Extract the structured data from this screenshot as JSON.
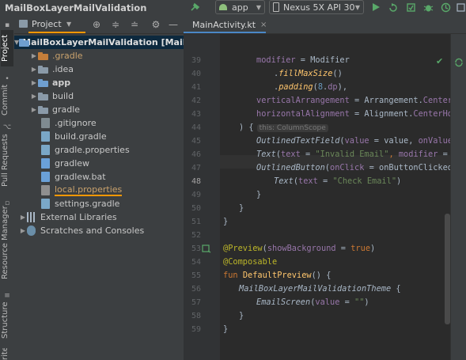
{
  "app": {
    "title": "MailBoxLayerMailValidation"
  },
  "toolbar": {
    "run_config": "app",
    "device": "Nexus 5X API 30"
  },
  "left_tabs": {
    "project": "Project",
    "commit": "Commit",
    "pull_requests": "Pull Requests",
    "resource_manager": "Resource Manager",
    "structure": "Structure",
    "favorites": "rites"
  },
  "project_panel": {
    "view_label": "Project",
    "tree": [
      {
        "label": "MailBoxLayerMailValidation [MailBoxLa",
        "level": 0,
        "type": "module",
        "expanded": true,
        "selected": true
      },
      {
        "label": ".gradle",
        "level": 1,
        "type": "folder-orange",
        "expanded": false
      },
      {
        "label": ".idea",
        "level": 1,
        "type": "folder",
        "expanded": false
      },
      {
        "label": "app",
        "level": 1,
        "type": "folder-module",
        "expanded": false
      },
      {
        "label": "build",
        "level": 1,
        "type": "folder",
        "expanded": false
      },
      {
        "label": "gradle",
        "level": 1,
        "type": "folder",
        "expanded": false
      },
      {
        "label": ".gitignore",
        "level": 1,
        "type": "file-git"
      },
      {
        "label": "build.gradle",
        "level": 1,
        "type": "file-gradle"
      },
      {
        "label": "gradle.properties",
        "level": 1,
        "type": "file-gradle"
      },
      {
        "label": "gradlew",
        "level": 1,
        "type": "file-sh"
      },
      {
        "label": "gradlew.bat",
        "level": 1,
        "type": "file-bat"
      },
      {
        "label": "local.properties",
        "level": 1,
        "type": "file-props"
      },
      {
        "label": "settings.gradle",
        "level": 1,
        "type": "file-gradle"
      },
      {
        "label": "External Libraries",
        "level": 0,
        "type": "libraries",
        "expanded": false
      },
      {
        "label": "Scratches and Consoles",
        "level": 0,
        "type": "scratches",
        "expanded": false
      }
    ]
  },
  "editor": {
    "tab_label": "MainActivity.kt",
    "inlay_hint": "this: ColumnScope",
    "current_line": "48",
    "line_numbers": [
      "39",
      "40",
      "41",
      "42",
      "43",
      "44",
      "45",
      "46",
      "47",
      "48",
      "49",
      "50",
      "51",
      "52",
      "53",
      "54",
      "55",
      "56",
      "57",
      "58",
      "59"
    ],
    "lines": {
      "l39": [
        [
          "modifier",
          "p"
        ],
        [
          " = Modifier",
          "d"
        ]
      ],
      "l40": [
        [
          ".",
          "d"
        ],
        [
          "fillMaxSize",
          "fi"
        ],
        [
          "()",
          "d"
        ]
      ],
      "l41": [
        [
          ".",
          "d"
        ],
        [
          "padding",
          "fi"
        ],
        [
          "(",
          "d"
        ],
        [
          "8",
          "n"
        ],
        [
          ".",
          "d"
        ],
        [
          "dp",
          "p"
        ],
        [
          "),",
          "d"
        ]
      ],
      "l42": [
        [
          "verticalArrangement",
          "p"
        ],
        [
          " = Arrangement.",
          "d"
        ],
        [
          "Center",
          "p"
        ],
        [
          ",",
          "k"
        ]
      ],
      "l43": [
        [
          "horizontalAlignment",
          "p"
        ],
        [
          " = Alignment.",
          "d"
        ],
        [
          "CenterHorizont",
          "p"
        ]
      ],
      "l45": [
        [
          "OutlinedTextField",
          "it"
        ],
        [
          "(",
          "d"
        ],
        [
          "value",
          "p"
        ],
        [
          " = value, ",
          "d"
        ],
        [
          "onValueChange",
          "p"
        ]
      ],
      "l46": [
        [
          "Text",
          "it"
        ],
        [
          "(",
          "d"
        ],
        [
          "text",
          "p"
        ],
        [
          " = ",
          "d"
        ],
        [
          "\"Invalid Email\"",
          "s"
        ],
        [
          ", ",
          "k"
        ],
        [
          "modifier",
          "p"
        ],
        [
          " = Modifi",
          "d"
        ]
      ],
      "l47": [
        [
          "OutlinedButton",
          "it"
        ],
        [
          "(",
          "d"
        ],
        [
          "onClick",
          "p"
        ],
        [
          " = onButtonClicked) {",
          "d"
        ]
      ],
      "l48": [
        [
          "Text",
          "it"
        ],
        [
          "(",
          "d"
        ],
        [
          "text",
          "p"
        ],
        [
          " = ",
          "d"
        ],
        [
          "\"Check Email\"",
          "s"
        ],
        [
          ")",
          "d"
        ]
      ],
      "l49": [
        [
          "}",
          "d"
        ]
      ],
      "l50": [
        [
          "}",
          "d"
        ]
      ],
      "l51": [
        [
          "}",
          "d"
        ]
      ],
      "l53": [
        [
          "@Preview",
          "a"
        ],
        [
          "(",
          "d"
        ],
        [
          "showBackground",
          "p"
        ],
        [
          " = ",
          "d"
        ],
        [
          "true",
          "k"
        ],
        [
          ")",
          "d"
        ]
      ],
      "l54": [
        [
          "@Composable",
          "a"
        ]
      ],
      "l55": [
        [
          "fun ",
          "k"
        ],
        [
          "DefaultPreview",
          "f"
        ],
        [
          "() {",
          "d"
        ]
      ],
      "l56": [
        [
          "MailBoxLayerMailValidationTheme",
          "it"
        ],
        [
          " {",
          "d"
        ]
      ],
      "l57": [
        [
          "EmailScreen",
          "it"
        ],
        [
          "(",
          "d"
        ],
        [
          "value",
          "p"
        ],
        [
          " = ",
          "d"
        ],
        [
          "\"\"",
          "s"
        ],
        [
          ")",
          "d"
        ]
      ],
      "l58": [
        [
          "}",
          "d"
        ]
      ],
      "l59": [
        [
          "}",
          "d"
        ]
      ],
      "l44": [
        [
          ") {",
          "d"
        ]
      ]
    }
  },
  "colors": {
    "accent_orange": "#ff9800",
    "selection": "#0d293e",
    "run_green": "#59a869",
    "keyword": "#cc7832",
    "string": "#6a8759"
  }
}
